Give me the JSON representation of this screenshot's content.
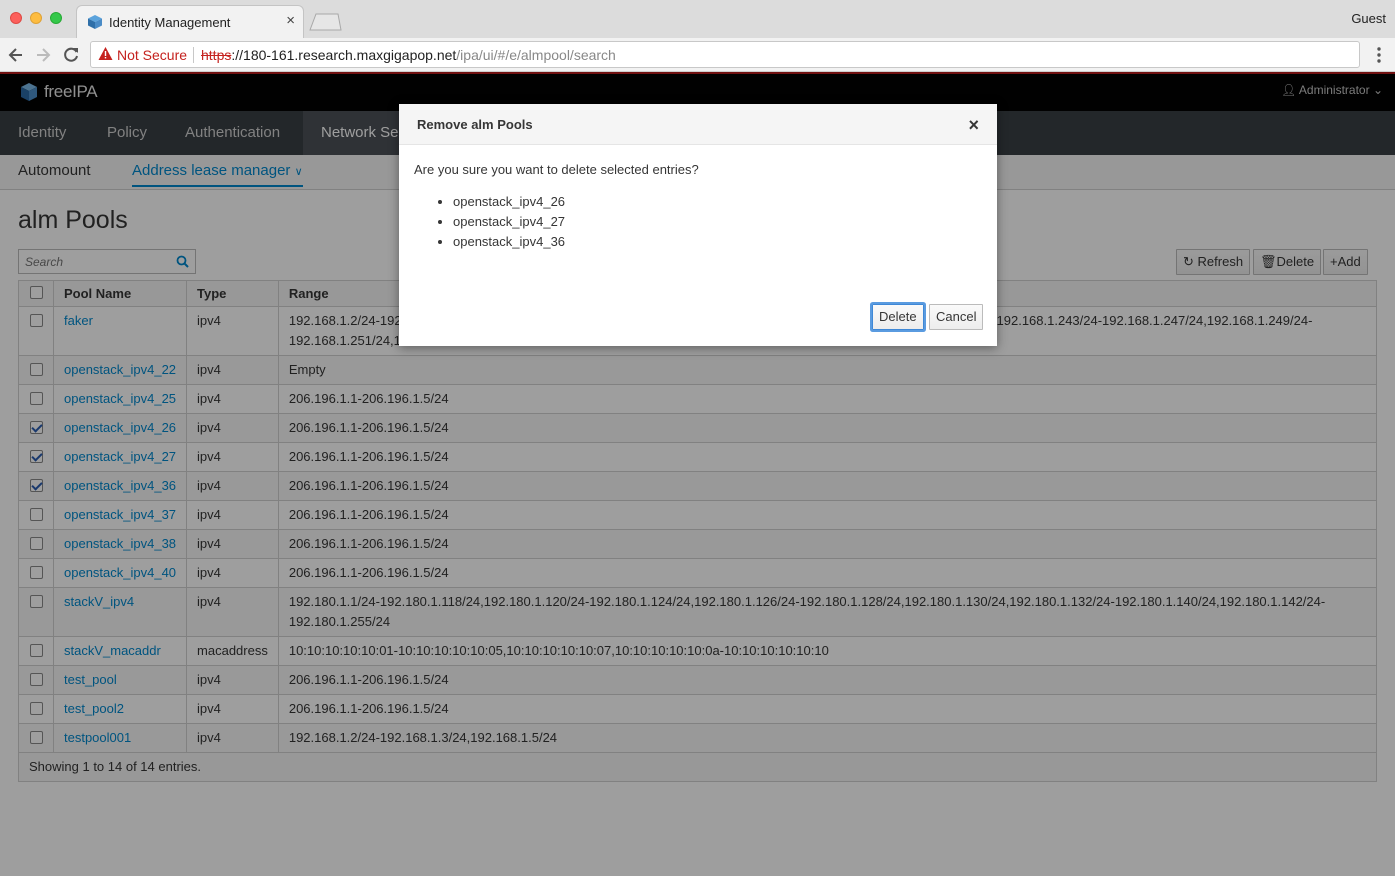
{
  "browser": {
    "tab_title": "Identity Management",
    "tab_close": "×",
    "profile": "Guest",
    "url_warning": "Not Secure",
    "url_scheme": "https",
    "url_sep": "://",
    "url_host": "180-161.research.maxgigapop.net",
    "url_path": "/ipa/ui/#/e/almpool/search"
  },
  "header": {
    "brand": "freeIPA",
    "user": "Administrator"
  },
  "nav": {
    "items": [
      {
        "label": "Identity"
      },
      {
        "label": "Policy"
      },
      {
        "label": "Authentication"
      },
      {
        "label": "Network Services"
      }
    ]
  },
  "subnav": {
    "items": [
      {
        "label": "Automount"
      },
      {
        "label": "Address lease manager"
      }
    ]
  },
  "page": {
    "title": "alm Pools",
    "search_placeholder": "Search",
    "refresh_label": "Refresh",
    "delete_label": "Delete",
    "add_label": "Add",
    "columns": [
      "Pool Name",
      "Type",
      "Range"
    ],
    "rows": [
      {
        "name": "faker",
        "type": "ipv4",
        "checked": false,
        "range": "192.168.1.2/24-192.168.1.73/24,192.168.1.77/24-192.168.1.183/24-192.168.1.202/24,192.168.1.204/24-192.168.1.241/24,192.168.1.243/24-192.168.1.247/24,192.168.1.249/24-192.168.1.251/24,192.168.1.253/24-192.168.1.255/24"
      },
      {
        "name": "openstack_ipv4_22",
        "type": "ipv4",
        "checked": false,
        "range": "Empty"
      },
      {
        "name": "openstack_ipv4_25",
        "type": "ipv4",
        "checked": false,
        "range": "206.196.1.1-206.196.1.5/24"
      },
      {
        "name": "openstack_ipv4_26",
        "type": "ipv4",
        "checked": true,
        "range": "206.196.1.1-206.196.1.5/24"
      },
      {
        "name": "openstack_ipv4_27",
        "type": "ipv4",
        "checked": true,
        "range": "206.196.1.1-206.196.1.5/24"
      },
      {
        "name": "openstack_ipv4_36",
        "type": "ipv4",
        "checked": true,
        "range": "206.196.1.1-206.196.1.5/24"
      },
      {
        "name": "openstack_ipv4_37",
        "type": "ipv4",
        "checked": false,
        "range": "206.196.1.1-206.196.1.5/24"
      },
      {
        "name": "openstack_ipv4_38",
        "type": "ipv4",
        "checked": false,
        "range": "206.196.1.1-206.196.1.5/24"
      },
      {
        "name": "openstack_ipv4_40",
        "type": "ipv4",
        "checked": false,
        "range": "206.196.1.1-206.196.1.5/24"
      },
      {
        "name": "stackV_ipv4",
        "type": "ipv4",
        "checked": false,
        "range": "192.180.1.1/24-192.180.1.118/24,192.180.1.120/24-192.180.1.124/24,192.180.1.126/24-192.180.1.128/24,192.180.1.130/24,192.180.1.132/24-192.180.1.140/24,192.180.1.142/24-192.180.1.255/24"
      },
      {
        "name": "stackV_macaddr",
        "type": "macaddress",
        "checked": false,
        "range": "10:10:10:10:10:01-10:10:10:10:10:05,10:10:10:10:10:07,10:10:10:10:10:0a-10:10:10:10:10:10"
      },
      {
        "name": "test_pool",
        "type": "ipv4",
        "checked": false,
        "range": "206.196.1.1-206.196.1.5/24"
      },
      {
        "name": "test_pool2",
        "type": "ipv4",
        "checked": false,
        "range": "206.196.1.1-206.196.1.5/24"
      },
      {
        "name": "testpool001",
        "type": "ipv4",
        "checked": false,
        "range": "192.168.1.2/24-192.168.1.3/24,192.168.1.5/24"
      }
    ],
    "footer": "Showing 1 to 14 of 14 entries."
  },
  "dialog": {
    "title": "Remove alm Pools",
    "close": "×",
    "message": "Are you sure you want to delete selected entries?",
    "entries": [
      "openstack_ipv4_26",
      "openstack_ipv4_27",
      "openstack_ipv4_36"
    ],
    "delete_label": "Delete",
    "cancel_label": "Cancel"
  }
}
